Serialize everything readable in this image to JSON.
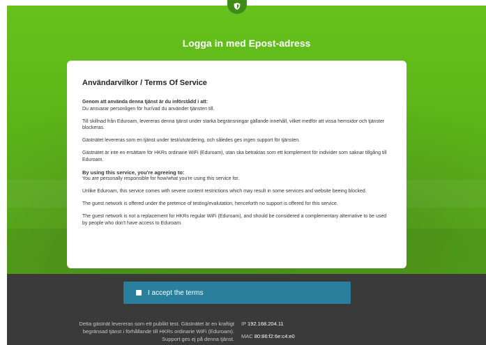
{
  "header": {
    "title": "Logga in med Epost-adress",
    "logo_icon": "shield-icon"
  },
  "terms": {
    "heading": "Användarvilkor / Terms Of Service",
    "sv": {
      "lead": "Genom att använda denna tjänst är du införstådd i att:",
      "responsibility": "Du ansvarar personligen för hur/vad du använder tjänsten till.",
      "restrictions": "Till skillnad från Eduroam, levereras denna tjänst under starka begränsningar gällande innehåll, vilket medför att vissa hemsidor och tjänster blockeras.",
      "testing": "Gästnätet levereras som en tjänst under test/utvärdering, och således ges ingen support för tjänsten.",
      "replacement": "Gästnätet är inte en ersättare för HKRs ordinarie WiFi (Eduroam), utan ska betraktas som ett komplement för individer som saknar tillgång till Eduroam."
    },
    "en": {
      "lead": "By using this service, you're agreeing to:",
      "responsibility": "You are personally responsible for how/what you're using this service for.",
      "restrictions": "Unlike Eduroam, this service comes with severe content restrictions which may result in some services and website beeing blocked.",
      "testing": "The guest network is offered under the pretence of testing/evalutation, henceforth no support is offered for this service.",
      "replacement": "The guest network is not a replacement for HKRs regular WiFi (Eduroam), and should be considered a complementary alternative to be used by people who don't have access to Eduroam."
    }
  },
  "accept": {
    "label": "I accept the terms",
    "checked": false
  },
  "footer": {
    "notice": "Detta gästnät levereras som ett publikt test. Gästnätet är en kraftigt begränsad tjänst i förhållande till HKRs ordinarie WiFi (Eduroam). Support ges ej på denna tjänst.",
    "ip_label": "IP",
    "ip_value": "192.168.204.11",
    "mac_label": "MAC",
    "mac_value": "80:86:f2:6e:c4:e0"
  },
  "colors": {
    "green": "#5cb518",
    "accept_blue": "#2a7f9c",
    "footer_dark": "#3a3a3a"
  }
}
